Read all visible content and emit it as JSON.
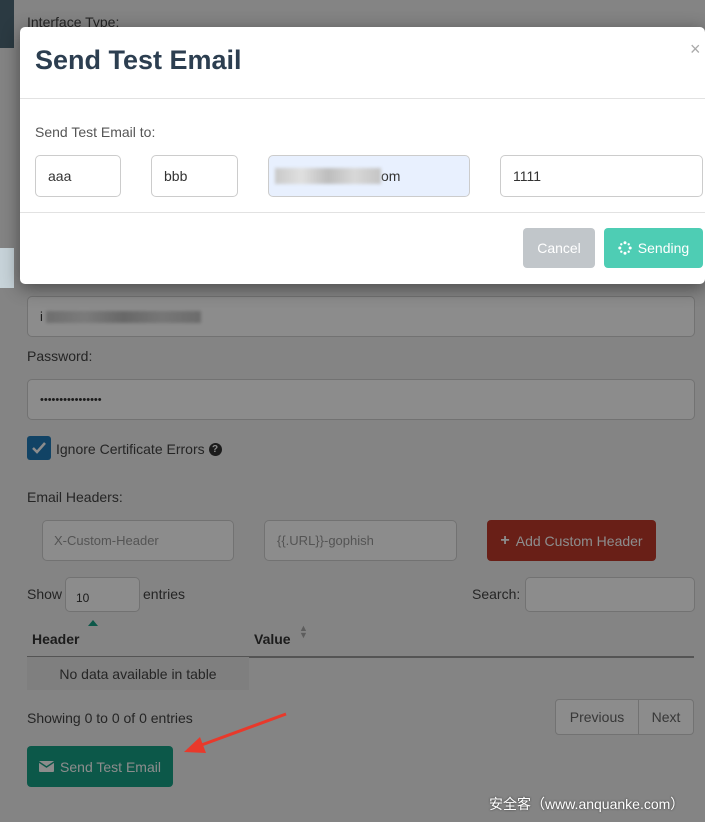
{
  "background_form": {
    "interface_type_label": "Interface Type:",
    "username_value_prefix": "i",
    "password_label": "Password:",
    "password_value": "••••••••••••••••",
    "ignore_cert_label": "Ignore Certificate Errors",
    "ignore_cert_checked": true,
    "email_headers_label": "Email Headers:",
    "header_name_placeholder": "X-Custom-Header",
    "header_value_placeholder": "{{.URL}}-gophish",
    "add_header_label": "Add Custom Header",
    "show_label": "Show",
    "entries_count": "10",
    "entries_label": "entries",
    "search_label": "Search:",
    "table": {
      "columns": [
        "Header",
        "Value"
      ],
      "empty_message": "No data available in table"
    },
    "showing_text": "Showing 0 to 0 of 0 entries",
    "previous_label": "Previous",
    "next_label": "Next",
    "send_test_label": "Send Test Email"
  },
  "modal": {
    "title": "Send Test Email",
    "close_symbol": "×",
    "to_label": "Send Test Email to:",
    "first_name": "aaa",
    "last_name": "bbb",
    "email_suffix": "om",
    "position": "1111",
    "cancel_label": "Cancel",
    "sending_label": "Sending"
  },
  "watermark": "安全客（www.anquanke.com）",
  "colors": {
    "add_header_button": "#c0392b",
    "send_button": "#16a085",
    "sending_button": "#4ecdb4",
    "cancel_button": "#c1c6ca",
    "checkbox": "#1f7ab8",
    "arrow": "#e8392b"
  }
}
